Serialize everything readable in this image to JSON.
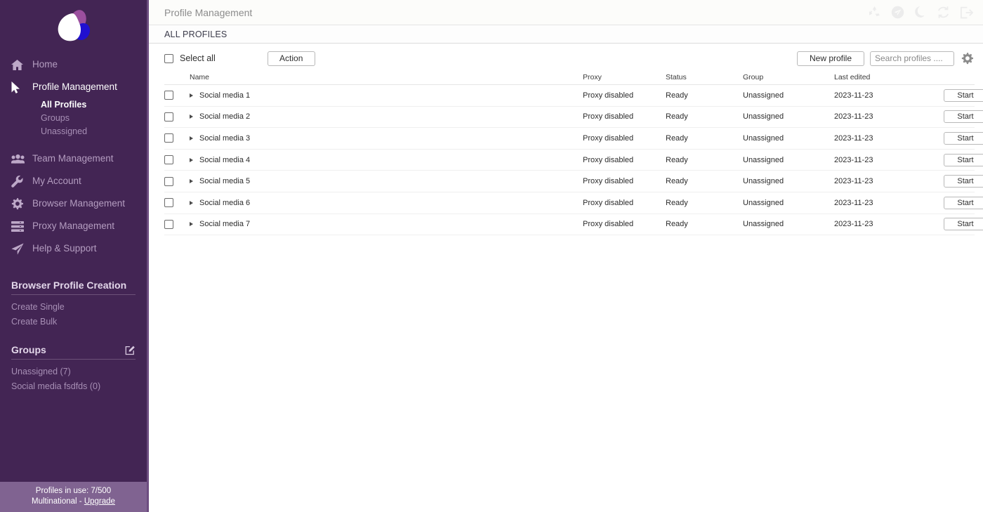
{
  "sidebar": {
    "logo_name": "butterfly-logo",
    "nav": [
      {
        "label": "Home",
        "icon": "home-icon",
        "active": false
      },
      {
        "label": "Profile Management",
        "icon": "cursor-icon",
        "active": true
      },
      {
        "label": "Team Management",
        "icon": "users-icon",
        "active": false
      },
      {
        "label": "My Account",
        "icon": "wrench-icon",
        "active": false
      },
      {
        "label": "Browser Management",
        "icon": "gear-icon",
        "active": false
      },
      {
        "label": "Proxy Management",
        "icon": "server-icon",
        "active": false
      },
      {
        "label": "Help & Support",
        "icon": "send-icon",
        "active": false
      }
    ],
    "subnav": [
      {
        "label": "All Profiles",
        "active": true
      },
      {
        "label": "Groups",
        "active": false
      },
      {
        "label": "Unassigned",
        "active": false
      }
    ],
    "creation_section": {
      "title": "Browser Profile Creation",
      "links": [
        "Create Single",
        "Create Bulk"
      ]
    },
    "groups_section": {
      "title": "Groups",
      "edit_icon": "edit-square-icon",
      "links": [
        "Unassigned (7)",
        "Social media fsdfds (0)"
      ]
    },
    "footer": {
      "usage": "Profiles in use:  7/500",
      "plan": "Multinational - ",
      "upgrade": "Upgrade"
    }
  },
  "header": {
    "title": "Profile Management",
    "icons": [
      {
        "name": "recycle-icon"
      },
      {
        "name": "telegram-icon"
      },
      {
        "name": "moon-icon"
      },
      {
        "name": "refresh-icon"
      },
      {
        "name": "logout-icon"
      }
    ]
  },
  "tabbar": {
    "active_tab": "ALL PROFILES"
  },
  "toolbar": {
    "select_all_label": "Select all",
    "action_label": "Action",
    "new_profile_label": "New profile",
    "search_placeholder": "Search profiles ....",
    "search_value": "",
    "settings_icon": "gear-icon"
  },
  "table": {
    "columns": [
      "Name",
      "Proxy",
      "Status",
      "Group",
      "Last edited"
    ],
    "start_label": "Start",
    "rows": [
      {
        "name": "Social media 1",
        "proxy": "Proxy disabled",
        "status": "Ready",
        "group": "Unassigned",
        "last_edited": "2023-11-23"
      },
      {
        "name": "Social media 2",
        "proxy": "Proxy disabled",
        "status": "Ready",
        "group": "Unassigned",
        "last_edited": "2023-11-23"
      },
      {
        "name": "Social media 3",
        "proxy": "Proxy disabled",
        "status": "Ready",
        "group": "Unassigned",
        "last_edited": "2023-11-23"
      },
      {
        "name": "Social media 4",
        "proxy": "Proxy disabled",
        "status": "Ready",
        "group": "Unassigned",
        "last_edited": "2023-11-23"
      },
      {
        "name": "Social media 5",
        "proxy": "Proxy disabled",
        "status": "Ready",
        "group": "Unassigned",
        "last_edited": "2023-11-23"
      },
      {
        "name": "Social media 6",
        "proxy": "Proxy disabled",
        "status": "Ready",
        "group": "Unassigned",
        "last_edited": "2023-11-23"
      },
      {
        "name": "Social media 7",
        "proxy": "Proxy disabled",
        "status": "Ready",
        "group": "Unassigned",
        "last_edited": "2023-11-23"
      }
    ]
  },
  "colors": {
    "sidebar_bg": "#432554",
    "sidebar_edge": "#6d4d80",
    "sidebar_footer_bg": "#806391",
    "accent_purple": "#9b4f9e",
    "accent_blue": "#2010d0"
  }
}
